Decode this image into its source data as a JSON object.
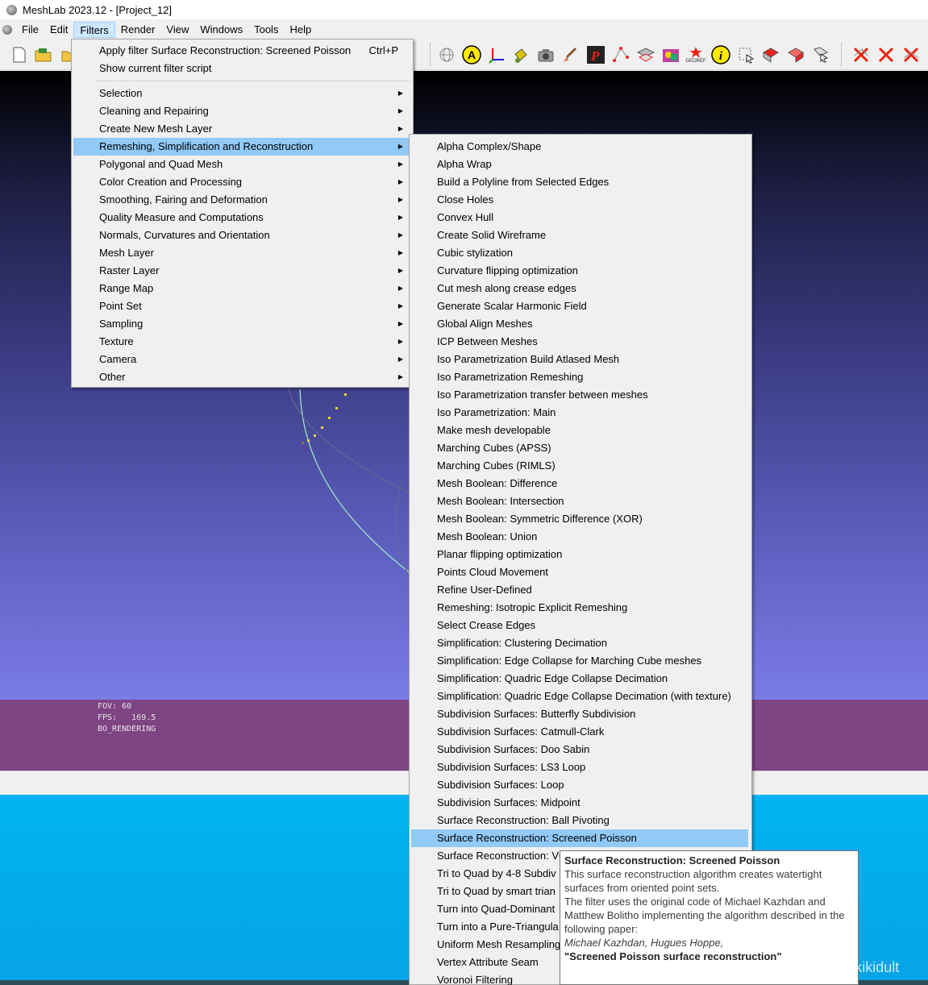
{
  "window": {
    "title": "MeshLab 2023.12 - [Project_12]"
  },
  "menubar": {
    "items": [
      {
        "label": "File"
      },
      {
        "label": "Edit"
      },
      {
        "label": "Filters"
      },
      {
        "label": "Render"
      },
      {
        "label": "View"
      },
      {
        "label": "Windows"
      },
      {
        "label": "Tools"
      },
      {
        "label": "Help"
      }
    ]
  },
  "viewport": {
    "info": {
      "fov": "FOV: 60",
      "fps": "FPS:   169.5",
      "mode": "BO_RENDERING"
    }
  },
  "filters_menu": {
    "apply": {
      "label": "Apply filter Surface Reconstruction: Screened Poisson",
      "shortcut": "Ctrl+P"
    },
    "show_script": "Show current filter script",
    "items": [
      "Selection",
      "Cleaning and Repairing",
      "Create New Mesh Layer",
      "Remeshing, Simplification and Reconstruction",
      "Polygonal and Quad Mesh",
      "Color Creation and Processing",
      "Smoothing, Fairing and Deformation",
      "Quality Measure and Computations",
      "Normals, Curvatures and Orientation",
      "Mesh Layer",
      "Raster Layer",
      "Range Map",
      "Point Set",
      "Sampling",
      "Texture",
      "Camera",
      "Other"
    ],
    "highlighted": "Remeshing, Simplification and Reconstruction"
  },
  "submenu": {
    "items": [
      "Alpha Complex/Shape",
      "Alpha Wrap",
      "Build a Polyline from Selected Edges",
      "Close Holes",
      "Convex Hull",
      "Create Solid Wireframe",
      "Cubic stylization",
      "Curvature flipping optimization",
      "Cut mesh along crease edges",
      "Generate Scalar Harmonic Field",
      "Global Align Meshes",
      "ICP Between Meshes",
      "Iso Parametrization Build Atlased Mesh",
      "Iso Parametrization Remeshing",
      "Iso Parametrization transfer between meshes",
      "Iso Parametrization: Main",
      "Make mesh developable",
      "Marching Cubes (APSS)",
      "Marching Cubes (RIMLS)",
      "Mesh Boolean: Difference",
      "Mesh Boolean: Intersection",
      "Mesh Boolean: Symmetric Difference (XOR)",
      "Mesh Boolean: Union",
      "Planar flipping optimization",
      "Points Cloud Movement",
      "Refine User-Defined",
      "Remeshing: Isotropic Explicit Remeshing",
      "Select Crease Edges",
      "Simplification: Clustering Decimation",
      "Simplification: Edge Collapse for Marching Cube meshes",
      "Simplification: Quadric Edge Collapse Decimation",
      "Simplification: Quadric Edge Collapse Decimation (with texture)",
      "Subdivision Surfaces: Butterfly Subdivision",
      "Subdivision Surfaces: Catmull-Clark",
      "Subdivision Surfaces: Doo Sabin",
      "Subdivision Surfaces: LS3 Loop",
      "Subdivision Surfaces: Loop",
      "Subdivision Surfaces: Midpoint",
      "Surface Reconstruction: Ball Pivoting",
      "Surface Reconstruction: Screened Poisson",
      "Surface Reconstruction: VC",
      "Tri to Quad by 4-8 Subdiv",
      "Tri to Quad by smart trian",
      "Turn into Quad-Dominant",
      "Turn into a Pure-Triangula",
      "Uniform Mesh Resampling",
      "Vertex Attribute Seam",
      "Voronoi Filtering"
    ],
    "highlighted": "Surface Reconstruction: Screened Poisson"
  },
  "tooltip": {
    "title": "Surface Reconstruction: Screened Poisson",
    "lines": [
      "This surface reconstruction algorithm creates watertight",
      "surfaces from oriented point sets.",
      "The filter uses the original code of Michael Kazhdan and",
      "Matthew Bolitho implementing the algorithm described in the",
      "following paper:"
    ],
    "authors": "Michael Kazhdan, Hugues Hoppe,",
    "paper": "\"Screened Poisson surface reconstruction\""
  },
  "toolbar": {
    "icons": [
      "new-icon",
      "open-icon",
      "open-project-icon",
      "sphere-grid-icon",
      "annotation-a-icon",
      "axis-icon",
      "paint-bucket-icon",
      "snapshot-icon",
      "brush-icon",
      "pick-points-icon",
      "select-vertices-icon",
      "align-icon",
      "texture-icon",
      "georef-icon",
      "info-icon",
      "select-icon",
      "select-faces-icon",
      "select-connected-icon",
      "select-cursor-icon",
      "delete-x-icon",
      "delete-face-icon",
      "delete-vertex-icon"
    ],
    "georef_label": "GEOREF"
  },
  "watermark": "CSDN @kikikidult",
  "colors": {
    "menu_highlight": "#91c9f7",
    "viewport_top": "#000000",
    "viewport_bottom": "#7a7ce6",
    "info_band": "#7e4483",
    "blue_panel": "#00b4f2"
  }
}
